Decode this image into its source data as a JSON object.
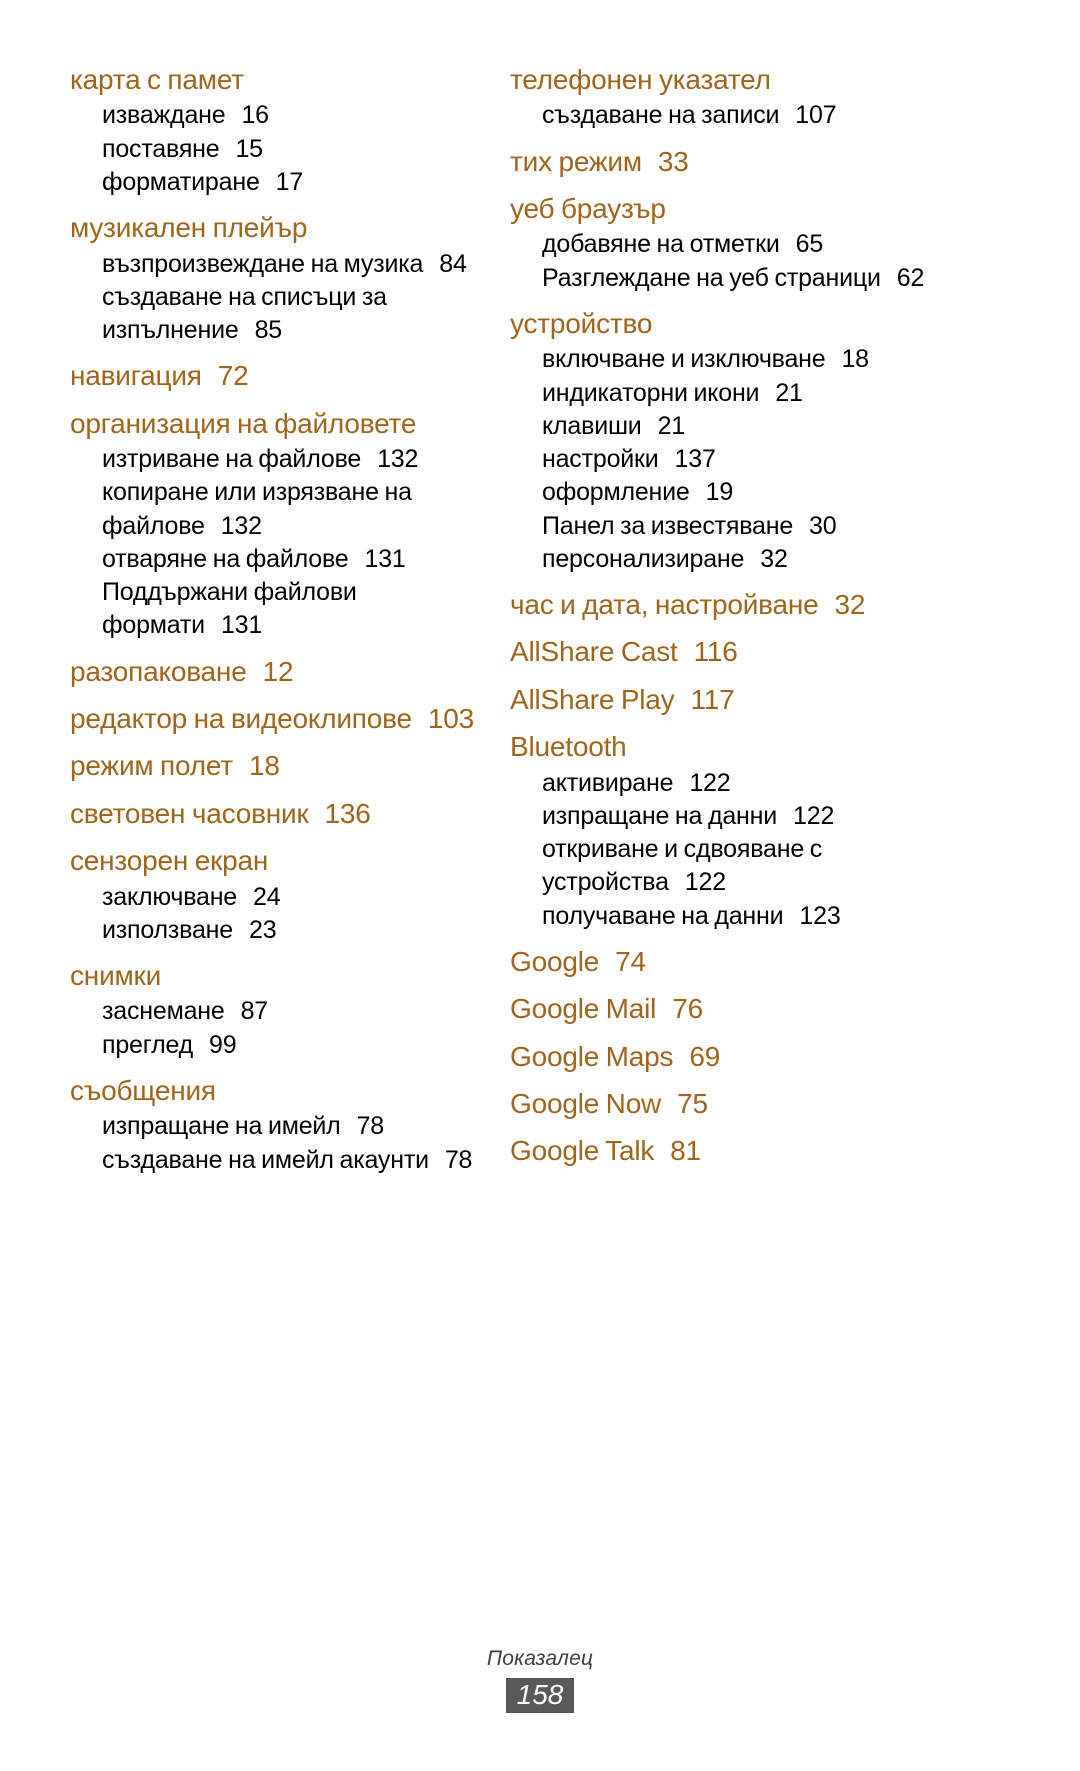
{
  "document": {
    "footer_label": "Показалец",
    "page_number": "158",
    "heading_color": "#A0651A",
    "sub_color": "#000000",
    "page_number_bg": "#595959"
  },
  "columns": {
    "left": [
      {
        "heading": "карта с памет",
        "heading_page": "",
        "subs": [
          {
            "label": "изваждане",
            "page": "16"
          },
          {
            "label": "поставяне",
            "page": "15"
          },
          {
            "label": "форматиране",
            "page": "17"
          }
        ]
      },
      {
        "heading": "музикален плейър",
        "heading_page": "",
        "subs": [
          {
            "label": "възпроизвеждане на музика",
            "page": "84"
          },
          {
            "label": "създаване на списъци за изпълнение",
            "page": "85"
          }
        ]
      },
      {
        "heading": "навигация",
        "heading_page": "72",
        "subs": []
      },
      {
        "heading": "организация на файловете",
        "heading_page": "",
        "subs": [
          {
            "label": "изтриване на файлове",
            "page": "132"
          },
          {
            "label": "копиране или изрязване на файлове",
            "page": "132"
          },
          {
            "label": "отваряне на файлове",
            "page": "131"
          },
          {
            "label": "Поддържани файлови формати",
            "page": "131"
          }
        ]
      },
      {
        "heading": "разопаковане",
        "heading_page": "12",
        "subs": []
      },
      {
        "heading": "редактор на видеоклипове",
        "heading_page": "103",
        "subs": []
      },
      {
        "heading": "режим полет",
        "heading_page": "18",
        "subs": []
      },
      {
        "heading": "световен часовник",
        "heading_page": "136",
        "subs": []
      },
      {
        "heading": "сензорен екран",
        "heading_page": "",
        "subs": [
          {
            "label": "заключване",
            "page": "24"
          },
          {
            "label": "използване",
            "page": "23"
          }
        ]
      },
      {
        "heading": "снимки",
        "heading_page": "",
        "subs": [
          {
            "label": "заснемане",
            "page": "87"
          },
          {
            "label": "преглед",
            "page": "99"
          }
        ]
      },
      {
        "heading": "съобщения",
        "heading_page": "",
        "subs": [
          {
            "label": "изпращане на имейл",
            "page": "78"
          },
          {
            "label": "създаване на имейл акаунти",
            "page": "78"
          }
        ]
      }
    ],
    "right": [
      {
        "heading": "телефонен указател",
        "heading_page": "",
        "subs": [
          {
            "label": "създаване на записи",
            "page": "107"
          }
        ]
      },
      {
        "heading": "тих режим",
        "heading_page": "33",
        "subs": []
      },
      {
        "heading": "уеб браузър",
        "heading_page": "",
        "subs": [
          {
            "label": "добавяне на отметки",
            "page": "65"
          },
          {
            "label": "Разглеждане на уеб страници",
            "page": "62"
          }
        ]
      },
      {
        "heading": "устройство",
        "heading_page": "",
        "subs": [
          {
            "label": "включване и изключване",
            "page": "18"
          },
          {
            "label": "индикаторни икони",
            "page": "21"
          },
          {
            "label": "клавиши",
            "page": "21"
          },
          {
            "label": "настройки",
            "page": "137"
          },
          {
            "label": "оформление",
            "page": "19"
          },
          {
            "label": "Панел за известяване",
            "page": "30"
          },
          {
            "label": "персонализиране",
            "page": "32"
          }
        ]
      },
      {
        "heading": "час и дата, настройване",
        "heading_page": "32",
        "subs": []
      },
      {
        "heading": "AllShare Cast",
        "heading_page": "116",
        "subs": []
      },
      {
        "heading": "AllShare Play",
        "heading_page": "117",
        "subs": []
      },
      {
        "heading": "Bluetooth",
        "heading_page": "",
        "subs": [
          {
            "label": "активиране",
            "page": "122"
          },
          {
            "label": "изпращане на данни",
            "page": "122"
          },
          {
            "label": "откриване и сдвояване с устройства",
            "page": "122"
          },
          {
            "label": "получаване на данни",
            "page": "123"
          }
        ]
      },
      {
        "heading": "Google",
        "heading_page": "74",
        "subs": []
      },
      {
        "heading": "Google Mail",
        "heading_page": "76",
        "subs": []
      },
      {
        "heading": "Google Maps",
        "heading_page": "69",
        "subs": []
      },
      {
        "heading": "Google Now",
        "heading_page": "75",
        "subs": []
      },
      {
        "heading": "Google Talk",
        "heading_page": "81",
        "subs": []
      }
    ]
  }
}
